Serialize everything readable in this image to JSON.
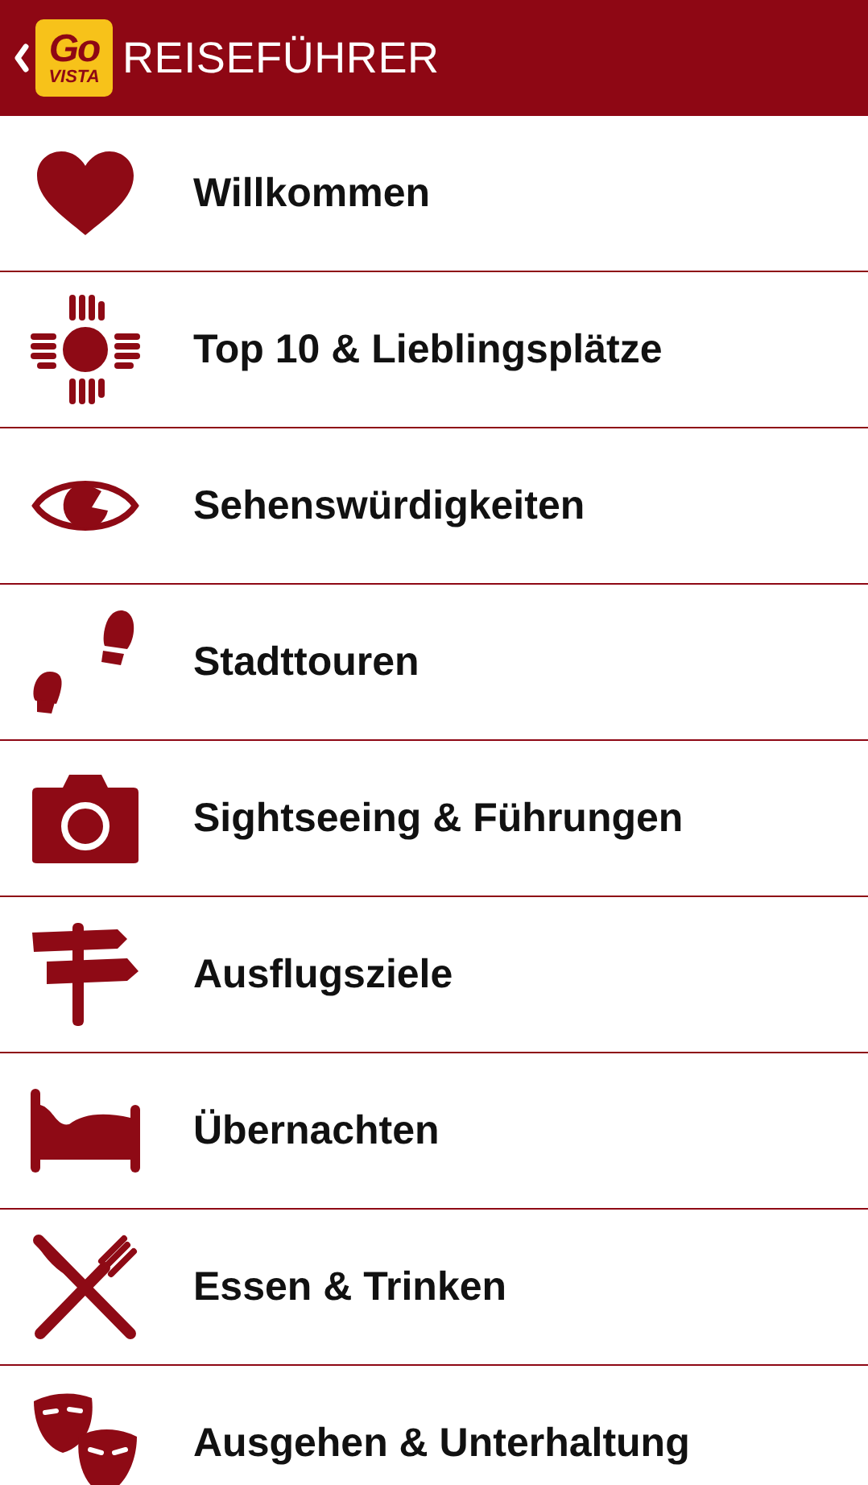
{
  "header": {
    "logo": {
      "top": "Go",
      "bottom": "VISTA"
    },
    "title": "REISEFÜHRER"
  },
  "menu": [
    {
      "kind": "heart",
      "label": "Willkommen"
    },
    {
      "kind": "sun",
      "label": "Top 10 & Lieblingsplätze"
    },
    {
      "kind": "eye",
      "label": "Sehenswürdigkeiten"
    },
    {
      "kind": "steps",
      "label": "Stadttouren"
    },
    {
      "kind": "camera",
      "label": "Sightseeing & Führungen"
    },
    {
      "kind": "signpost",
      "label": "Ausflugsziele"
    },
    {
      "kind": "bed",
      "label": "Übernachten"
    },
    {
      "kind": "cutlery",
      "label": "Essen & Trinken"
    },
    {
      "kind": "masks",
      "label": "Ausgehen & Unterhaltung"
    }
  ]
}
